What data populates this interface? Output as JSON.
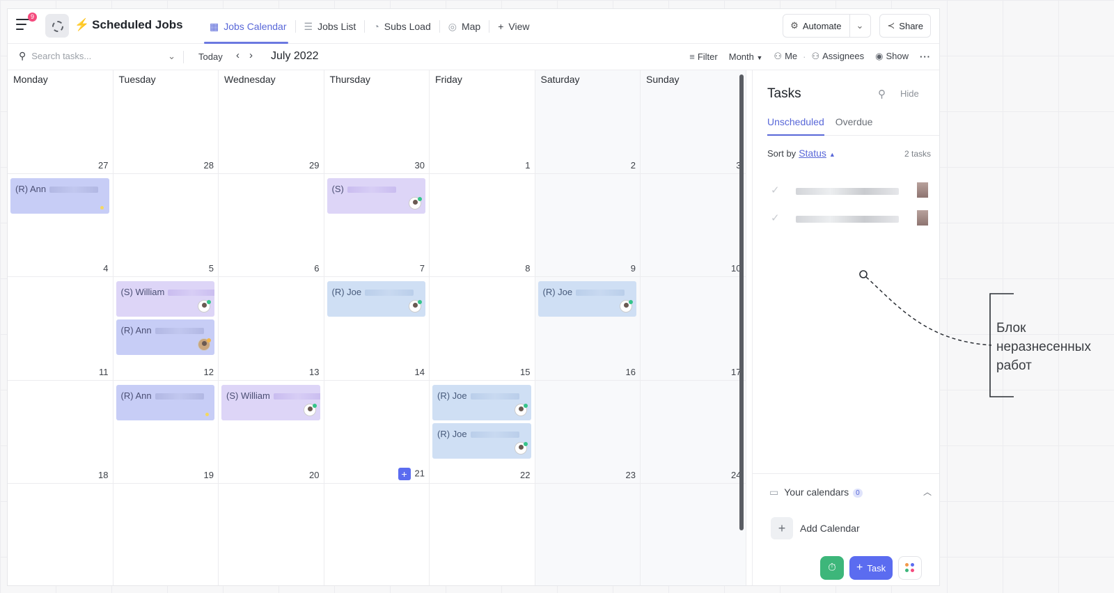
{
  "header": {
    "notifications": "9",
    "title": "Scheduled Jobs",
    "tabs": [
      {
        "label": "Jobs Calendar",
        "icon": "calendar-icon"
      },
      {
        "label": "Jobs List",
        "icon": "list-icon"
      },
      {
        "label": "Subs Load",
        "icon": "gauge-icon"
      },
      {
        "label": "Map",
        "icon": "map-pin-icon"
      },
      {
        "label": "View",
        "icon": "plus-icon"
      }
    ],
    "automate_label": "Automate",
    "share_label": "Share"
  },
  "toolbar": {
    "search_placeholder": "Search tasks...",
    "today_label": "Today",
    "month_label": "July 2022",
    "filter_label": "Filter",
    "view_mode": "Month",
    "me_label": "Me",
    "assignees_label": "Assignees",
    "show_label": "Show"
  },
  "calendar": {
    "weekdays": [
      "Monday",
      "Tuesday",
      "Wednesday",
      "Thursday",
      "Friday",
      "Saturday",
      "Sunday"
    ],
    "weeks": [
      [
        "27",
        "28",
        "29",
        "30",
        "1",
        "2",
        "3"
      ],
      [
        "4",
        "5",
        "6",
        "7",
        "8",
        "9",
        "10"
      ],
      [
        "11",
        "12",
        "13",
        "14",
        "15",
        "16",
        "17"
      ],
      [
        "18",
        "19",
        "20",
        "21",
        "22",
        "23",
        "24"
      ],
      [
        "",
        "",
        "",
        "",
        "",
        "",
        ""
      ]
    ],
    "events": [
      {
        "label": "(R) Ann",
        "kind": "ann"
      },
      {
        "label": "(S)",
        "kind": "sch"
      },
      {
        "label": "(S) William",
        "kind": "sch"
      },
      {
        "label": "(R) Ann",
        "kind": "ann"
      },
      {
        "label": "(R) Joe",
        "kind": "joe"
      },
      {
        "label": "(R) Joe",
        "kind": "joe"
      },
      {
        "label": "(R) Ann",
        "kind": "ann"
      },
      {
        "label": "(S) William",
        "kind": "sch"
      },
      {
        "label": "(R) Joe",
        "kind": "joe"
      },
      {
        "label": "(R) Joe",
        "kind": "joe"
      }
    ]
  },
  "tasks_panel": {
    "title": "Tasks",
    "hide_label": "Hide",
    "tabs": [
      "Unscheduled",
      "Overdue"
    ],
    "sort_by_label": "Sort by",
    "sort_field": "Status",
    "task_count": "2 tasks",
    "calendars_title": "Your calendars",
    "calendars_count": "0",
    "add_calendar_label": "Add Calendar",
    "new_task_label": "Task"
  },
  "annotation": {
    "lines": [
      "Блок",
      "неразнесенных",
      "работ"
    ]
  },
  "colors": {
    "accent": "#5867d8",
    "event_ann": "#c7cdf6",
    "event_sch": "#ddd5f7",
    "event_joe": "#cfdff4",
    "timer_green": "#3db67a"
  }
}
